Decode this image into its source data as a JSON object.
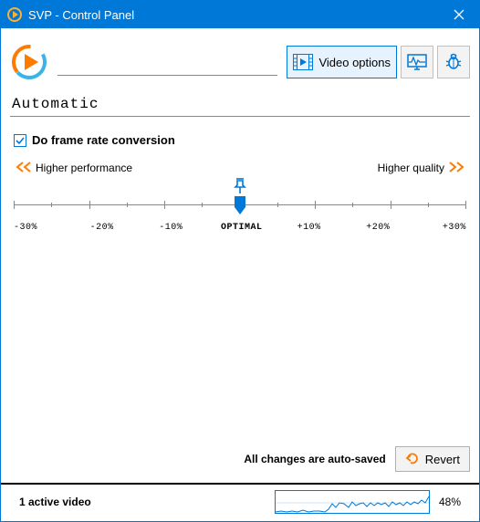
{
  "title": "SVP - Control Panel",
  "toolbar": {
    "video_options_label": "Video options"
  },
  "mode_label": "Automatic",
  "frame_checkbox": {
    "checked": true,
    "label": "Do frame rate conversion"
  },
  "slider": {
    "left_label": "Higher performance",
    "right_label": "Higher quality",
    "ticks": [
      "-30%",
      "-20%",
      "-10%",
      "OPTIMAL",
      "+10%",
      "+20%",
      "+30%"
    ],
    "value_index": 3
  },
  "autosave_label": "All changes are auto-saved",
  "revert_label": "Revert",
  "status": {
    "videos_label": "1 active video",
    "percent_label": "48%"
  }
}
